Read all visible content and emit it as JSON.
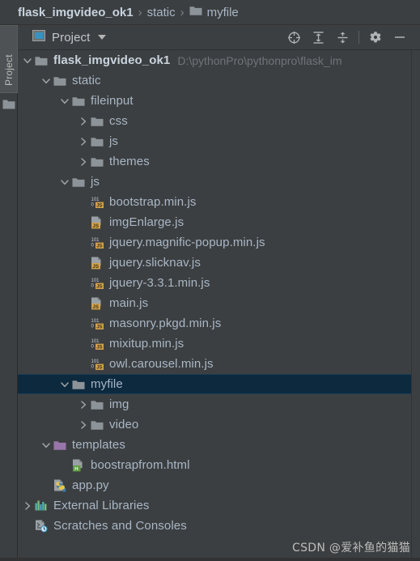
{
  "breadcrumb": {
    "segments": [
      {
        "label": "flask_imgvideo_ok1",
        "bold": true,
        "icon": "none"
      },
      {
        "label": "static",
        "bold": false,
        "icon": "none"
      },
      {
        "label": "myfile",
        "bold": false,
        "icon": "folder-icon"
      }
    ],
    "separator": "›"
  },
  "tool_strip": {
    "tab_label": "Project",
    "icon": "folder-icon"
  },
  "tool_window": {
    "title": "Project",
    "title_icon": "project-view-icon",
    "dropdown_icon": "chevron-down-icon",
    "actions": [
      {
        "name": "scroll-from-source-button",
        "icon": "crosshair-target-icon",
        "tooltip": "Select Opened File"
      },
      {
        "name": "expand-all-button",
        "icon": "expand-all-icon",
        "tooltip": "Expand All"
      },
      {
        "name": "collapse-all-button",
        "icon": "collapse-all-icon",
        "tooltip": "Collapse All"
      },
      {
        "name": "settings-button",
        "icon": "gear-icon",
        "tooltip": "Settings"
      },
      {
        "name": "hide-button",
        "icon": "minimize-icon",
        "tooltip": "Hide"
      }
    ]
  },
  "colors": {
    "background": "#3c3f41",
    "selection": "#0d293e",
    "text": "#a9b7c6",
    "muted_text": "#6e7479",
    "folder": "#8c9499",
    "template_folder": "#9876aa",
    "js_badge": "#d2a24c",
    "html_badge": "#5a9e3f",
    "accent_blue": "#3592c4"
  },
  "tree": {
    "rows": [
      {
        "label": "flask_imgvideo_ok1",
        "depth": 0,
        "arrow": "expanded",
        "icon": "folder-icon",
        "bold": true,
        "selected": false,
        "path_hint": "D:\\pythonPro\\pythonpro\\flask_im"
      },
      {
        "label": "static",
        "depth": 1,
        "arrow": "expanded",
        "icon": "folder-icon",
        "bold": false,
        "selected": false
      },
      {
        "label": "fileinput",
        "depth": 2,
        "arrow": "expanded",
        "icon": "folder-icon",
        "bold": false,
        "selected": false
      },
      {
        "label": "css",
        "depth": 3,
        "arrow": "collapsed",
        "icon": "folder-icon",
        "bold": false,
        "selected": false
      },
      {
        "label": "js",
        "depth": 3,
        "arrow": "collapsed",
        "icon": "folder-icon",
        "bold": false,
        "selected": false
      },
      {
        "label": "themes",
        "depth": 3,
        "arrow": "collapsed",
        "icon": "folder-icon",
        "bold": false,
        "selected": false
      },
      {
        "label": "js",
        "depth": 2,
        "arrow": "expanded",
        "icon": "folder-icon",
        "bold": false,
        "selected": false
      },
      {
        "label": "bootstrap.min.js",
        "depth": 3,
        "arrow": "none",
        "icon": "js-min-file-icon",
        "bold": false,
        "selected": false
      },
      {
        "label": "imgEnlarge.js",
        "depth": 3,
        "arrow": "none",
        "icon": "js-file-icon",
        "bold": false,
        "selected": false
      },
      {
        "label": "jquery.magnific-popup.min.js",
        "depth": 3,
        "arrow": "none",
        "icon": "js-min-file-icon",
        "bold": false,
        "selected": false
      },
      {
        "label": "jquery.slicknav.js",
        "depth": 3,
        "arrow": "none",
        "icon": "js-file-icon",
        "bold": false,
        "selected": false
      },
      {
        "label": "jquery-3.3.1.min.js",
        "depth": 3,
        "arrow": "none",
        "icon": "js-min-file-icon",
        "bold": false,
        "selected": false
      },
      {
        "label": "main.js",
        "depth": 3,
        "arrow": "none",
        "icon": "js-file-icon",
        "bold": false,
        "selected": false
      },
      {
        "label": "masonry.pkgd.min.js",
        "depth": 3,
        "arrow": "none",
        "icon": "js-min-file-icon",
        "bold": false,
        "selected": false
      },
      {
        "label": "mixitup.min.js",
        "depth": 3,
        "arrow": "none",
        "icon": "js-min-file-icon",
        "bold": false,
        "selected": false
      },
      {
        "label": "owl.carousel.min.js",
        "depth": 3,
        "arrow": "none",
        "icon": "js-min-file-icon",
        "bold": false,
        "selected": false
      },
      {
        "label": "myfile",
        "depth": 2,
        "arrow": "expanded",
        "icon": "folder-icon",
        "bold": false,
        "selected": true
      },
      {
        "label": "img",
        "depth": 3,
        "arrow": "collapsed",
        "icon": "folder-icon",
        "bold": false,
        "selected": false
      },
      {
        "label": "video",
        "depth": 3,
        "arrow": "collapsed",
        "icon": "folder-icon",
        "bold": false,
        "selected": false
      },
      {
        "label": "templates",
        "depth": 1,
        "arrow": "expanded",
        "icon": "template-folder-icon",
        "bold": false,
        "selected": false
      },
      {
        "label": "boostrapfrom.html",
        "depth": 2,
        "arrow": "none",
        "icon": "html-file-icon",
        "bold": false,
        "selected": false
      },
      {
        "label": "app.py",
        "depth": 1,
        "arrow": "none",
        "icon": "python-file-icon",
        "bold": false,
        "selected": false
      },
      {
        "label": "External Libraries",
        "depth": 0,
        "arrow": "collapsed",
        "icon": "libraries-icon",
        "bold": false,
        "selected": false
      },
      {
        "label": "Scratches and Consoles",
        "depth": 0,
        "arrow": "none",
        "icon": "scratches-icon",
        "bold": false,
        "selected": false
      }
    ]
  },
  "watermark": {
    "text": "CSDN @爱补鱼的猫猫"
  }
}
